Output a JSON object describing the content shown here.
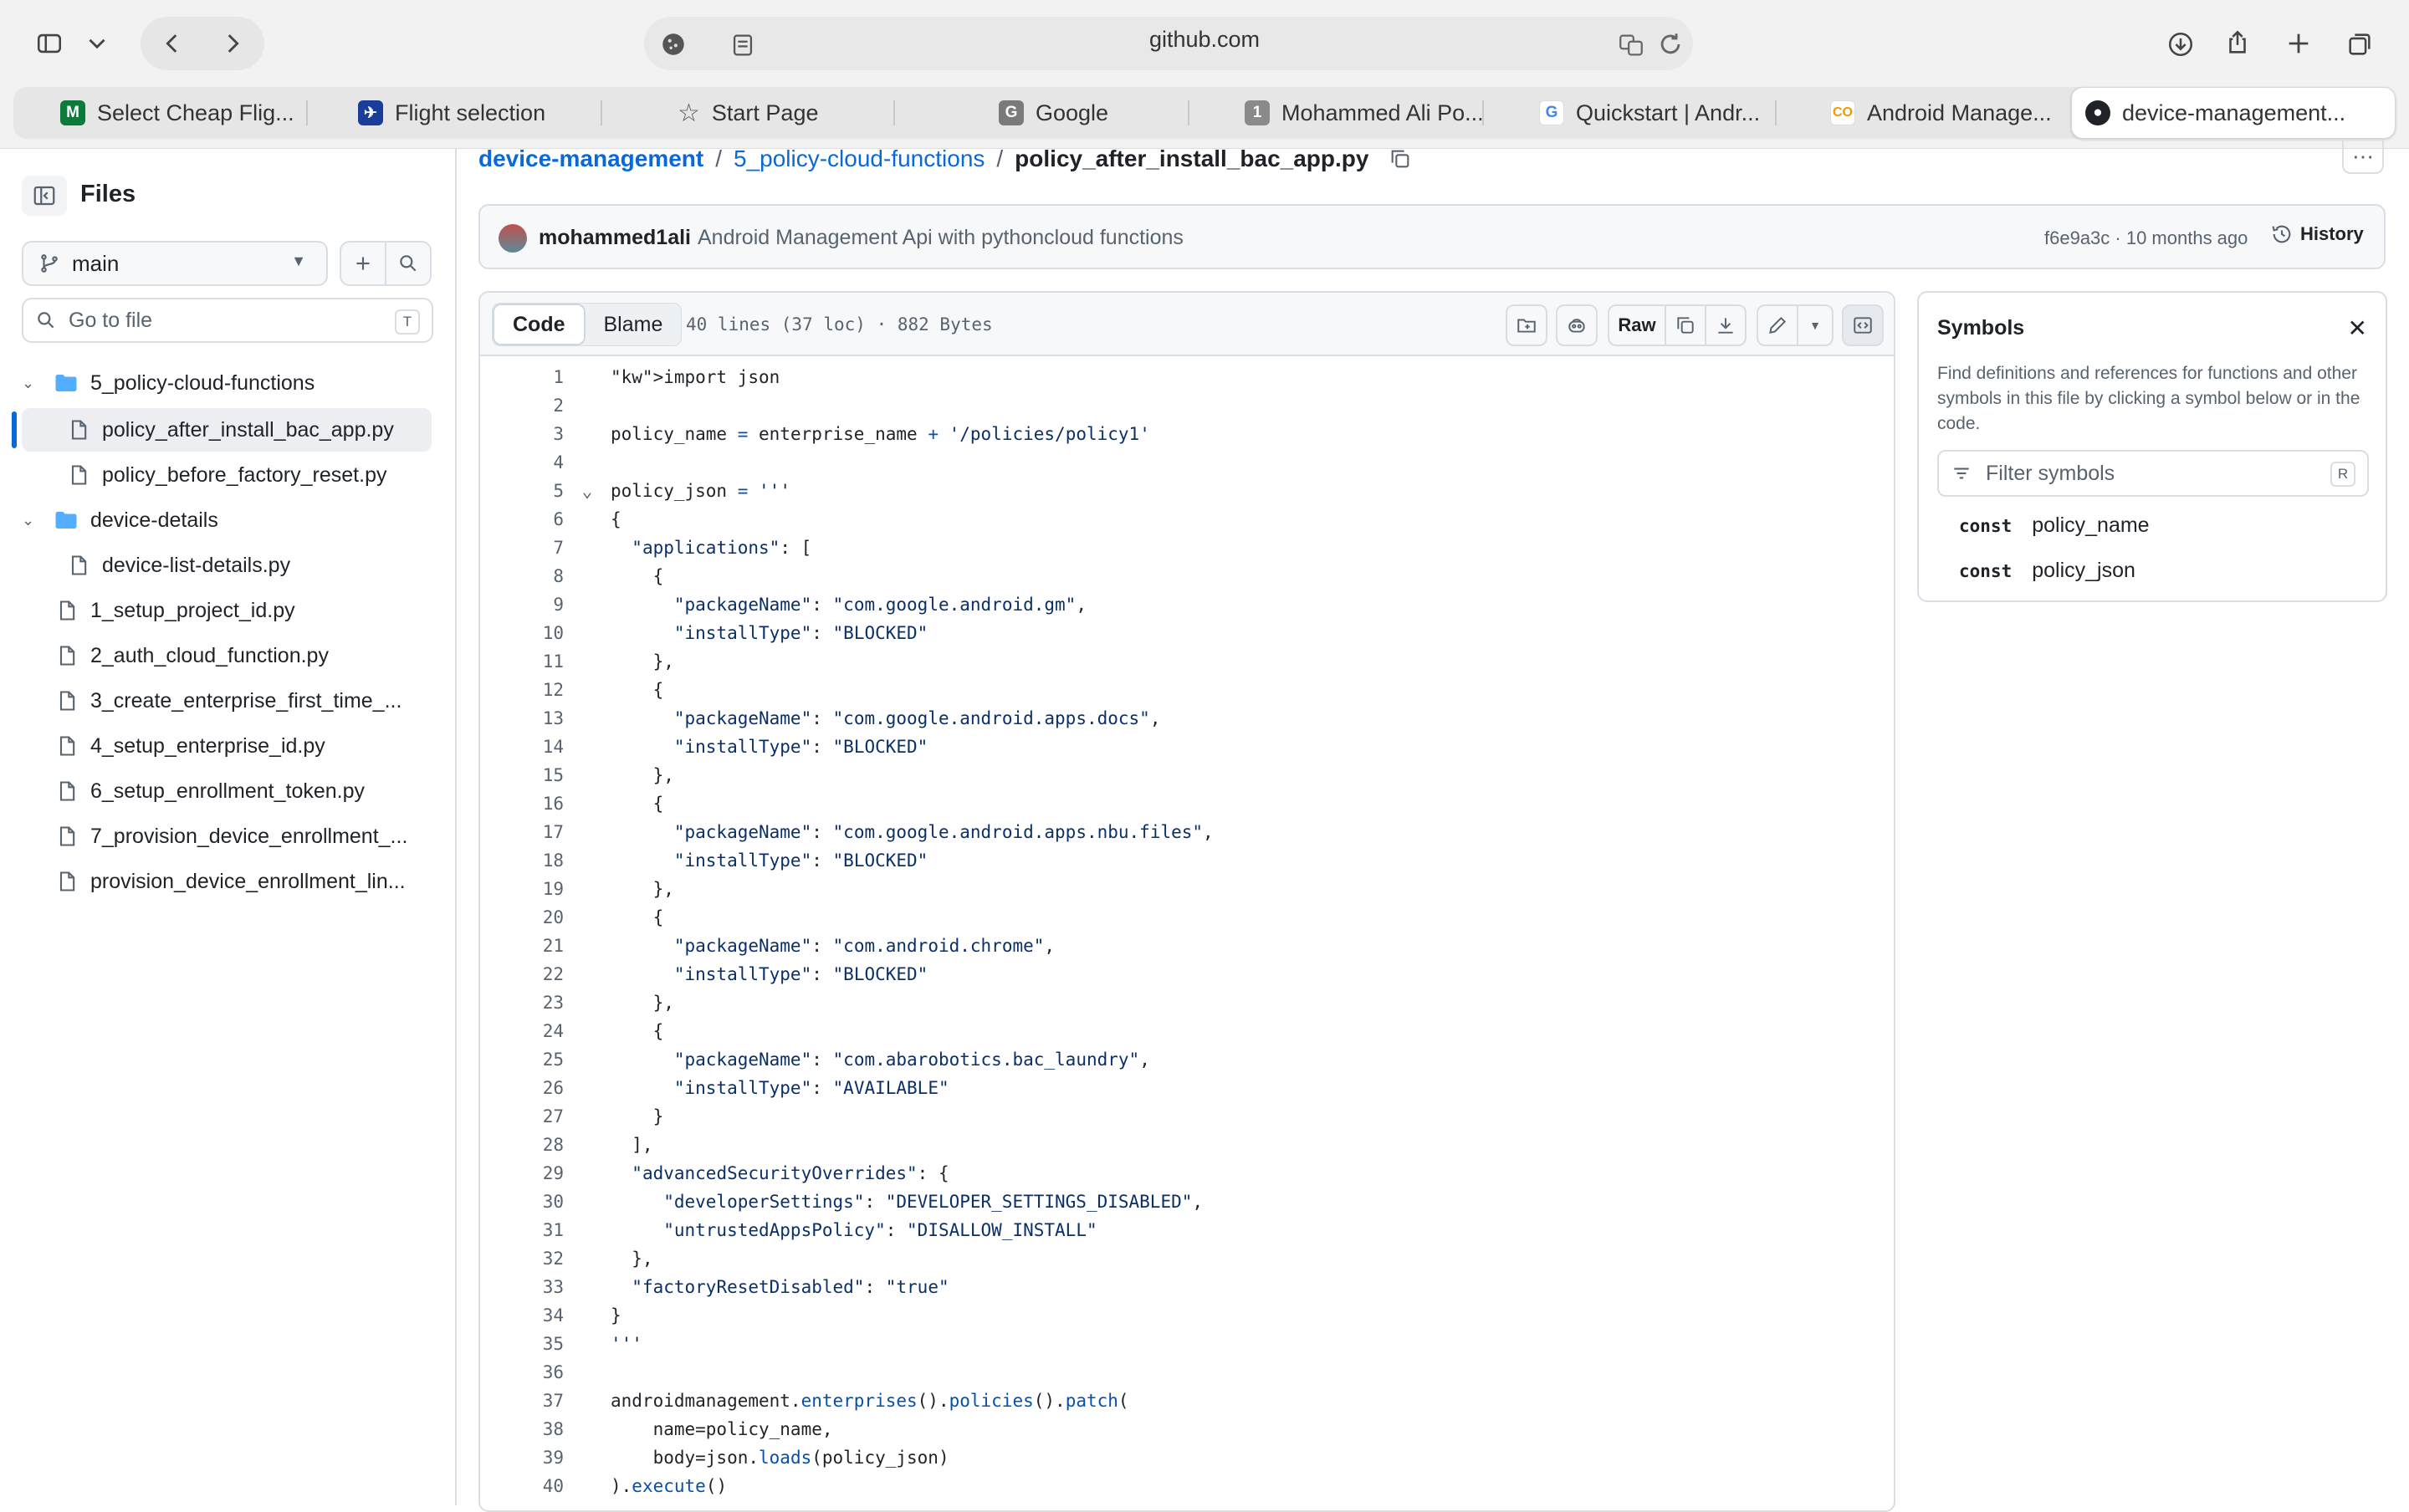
{
  "browser": {
    "url": "github.com",
    "tabs": [
      {
        "label": "Select Cheap Flig...",
        "icon": "m-icon"
      },
      {
        "label": "Flight selection",
        "icon": "airline-icon"
      },
      {
        "label": "Start Page",
        "icon": "star-icon"
      },
      {
        "label": "Google",
        "icon": "g-icon"
      },
      {
        "label": "Mohammed Ali Po...",
        "icon": "one-icon"
      },
      {
        "label": "Quickstart  |  Andr...",
        "icon": "google-icon"
      },
      {
        "label": "Android Manage...",
        "icon": "co-icon"
      },
      {
        "label": "device-management...",
        "icon": "github-icon"
      }
    ]
  },
  "sidebar": {
    "title": "Files",
    "branch": "main",
    "go_to_file": "Go to file",
    "go_to_file_key": "T",
    "tree": [
      {
        "label": "5_policy-cloud-functions",
        "type": "folder",
        "level": 0
      },
      {
        "label": "policy_after_install_bac_app.py",
        "type": "file",
        "level": 1
      },
      {
        "label": "policy_before_factory_reset.py",
        "type": "file",
        "level": 1
      },
      {
        "label": "device-details",
        "type": "folder",
        "level": 0
      },
      {
        "label": "device-list-details.py",
        "type": "file",
        "level": 1
      },
      {
        "label": "1_setup_project_id.py",
        "type": "file",
        "level": 0
      },
      {
        "label": "2_auth_cloud_function.py",
        "type": "file",
        "level": 0
      },
      {
        "label": "3_create_enterprise_first_time_...",
        "type": "file",
        "level": 0
      },
      {
        "label": "4_setup_enterprise_id.py",
        "type": "file",
        "level": 0
      },
      {
        "label": "6_setup_enrollment_token.py",
        "type": "file",
        "level": 0
      },
      {
        "label": "7_provision_device_enrollment_...",
        "type": "file",
        "level": 0
      },
      {
        "label": "provision_device_enrollment_lin...",
        "type": "file",
        "level": 0
      }
    ]
  },
  "breadcrumb": {
    "repo": "device-management",
    "folder": "5_policy-cloud-functions",
    "file": "policy_after_install_bac_app.py",
    "sep": "/"
  },
  "commit": {
    "author": "mohammed1ali",
    "message": "Android Management Api with pythoncloud functions",
    "meta": "f6e9a3c · 10 months ago",
    "history": "History"
  },
  "file_header": {
    "code_tab": "Code",
    "blame_tab": "Blame",
    "meta": "40 lines (37 loc) · 882 Bytes",
    "raw": "Raw"
  },
  "code_lines": [
    "import json",
    "",
    "policy_name = enterprise_name + '/policies/policy1'",
    "",
    "policy_json = '''",
    "{",
    "  \"applications\": [",
    "    {",
    "      \"packageName\": \"com.google.android.gm\",",
    "      \"installType\": \"BLOCKED\"",
    "    },",
    "    {",
    "      \"packageName\": \"com.google.android.apps.docs\",",
    "      \"installType\": \"BLOCKED\"",
    "    },",
    "    {",
    "      \"packageName\": \"com.google.android.apps.nbu.files\",",
    "      \"installType\": \"BLOCKED\"",
    "    },",
    "    {",
    "      \"packageName\": \"com.android.chrome\",",
    "      \"installType\": \"BLOCKED\"",
    "    },",
    "    {",
    "      \"packageName\": \"com.abarobotics.bac_laundry\",",
    "      \"installType\": \"AVAILABLE\"",
    "    }",
    "  ],",
    "  \"advancedSecurityOverrides\": {",
    "     \"developerSettings\": \"DEVELOPER_SETTINGS_DISABLED\",",
    "     \"untrustedAppsPolicy\": \"DISALLOW_INSTALL\"",
    "  },",
    "  \"factoryResetDisabled\": \"true\"",
    "}",
    "'''",
    "",
    "androidmanagement.enterprises().policies().patch(",
    "    name=policy_name,",
    "    body=json.loads(policy_json)",
    ").execute()"
  ],
  "symbols": {
    "title": "Symbols",
    "description": "Find definitions and references for functions and other symbols in this file by clicking a symbol below or in the code.",
    "filter_placeholder": "Filter symbols",
    "filter_key": "R",
    "items": [
      {
        "kind": "const",
        "name": "policy_name"
      },
      {
        "kind": "const",
        "name": "policy_json"
      }
    ]
  }
}
